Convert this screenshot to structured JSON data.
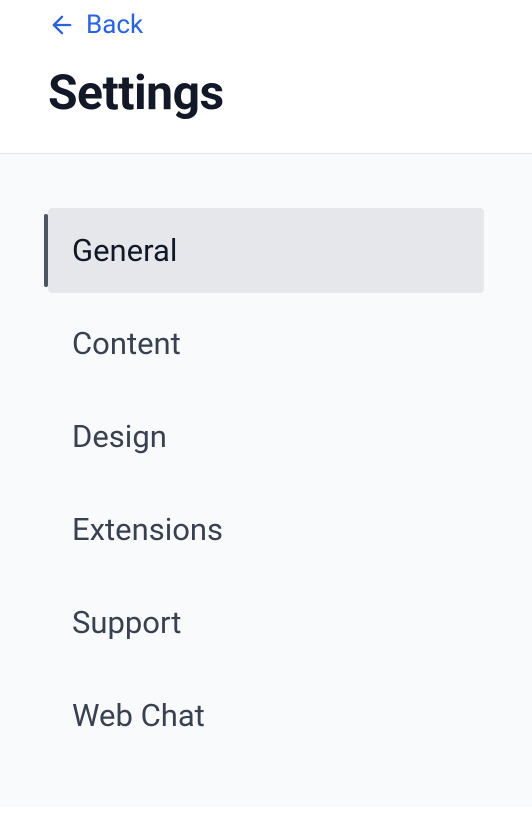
{
  "header": {
    "back_label": "Back",
    "title": "Settings"
  },
  "nav": {
    "items": [
      {
        "label": "General",
        "active": true
      },
      {
        "label": "Content",
        "active": false
      },
      {
        "label": "Design",
        "active": false
      },
      {
        "label": "Extensions",
        "active": false
      },
      {
        "label": "Support",
        "active": false
      },
      {
        "label": "Web Chat",
        "active": false
      }
    ]
  }
}
